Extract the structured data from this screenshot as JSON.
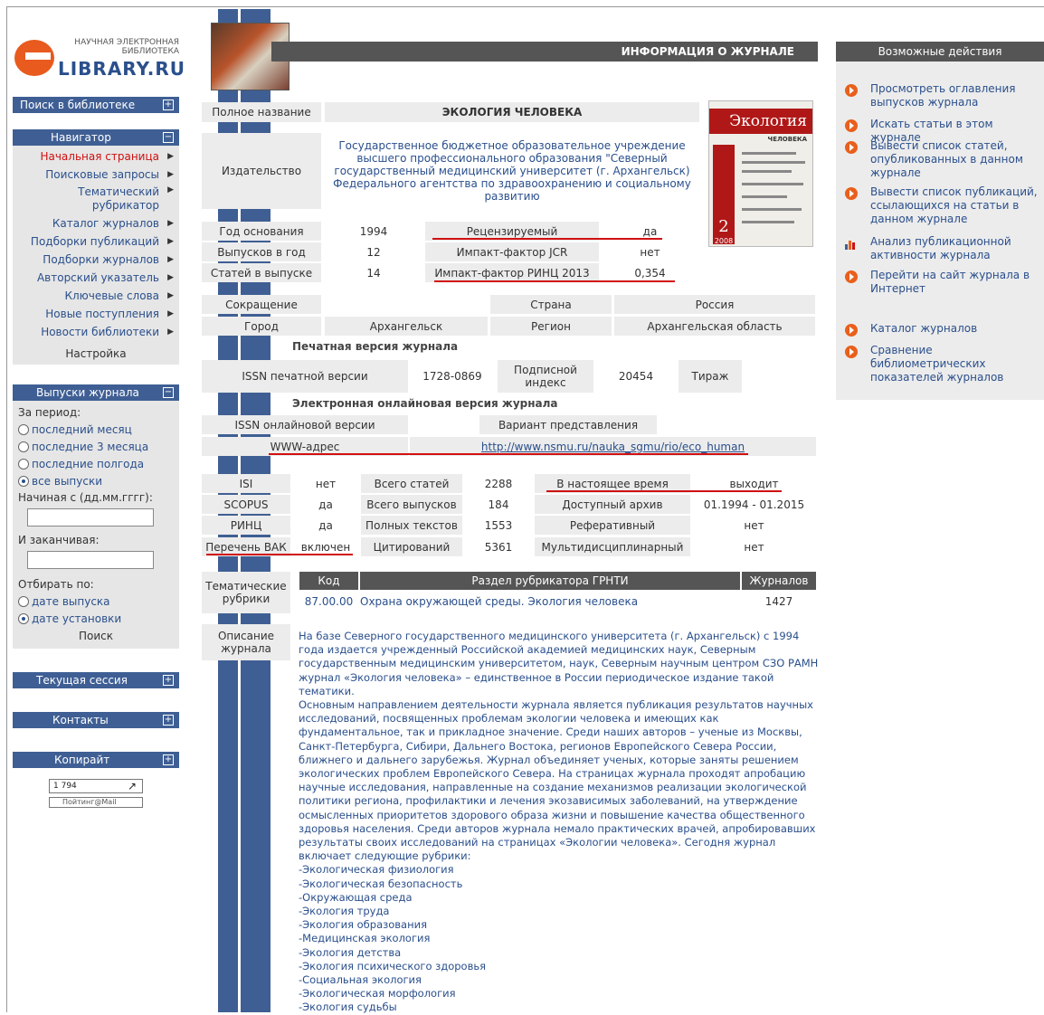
{
  "logo": {
    "line1": "НАУЧНАЯ ЭЛЕКТРОННАЯ",
    "line2": "БИБЛИОТЕКА",
    "brand": "LIBRARY.RU"
  },
  "left": {
    "search_panel": "Поиск в библиотеке",
    "navigator_panel": "Навигатор",
    "nav_items": [
      "Начальная страница",
      "Поисковые запросы",
      "Тематический рубрикатор",
      "Каталог журналов",
      "Подборки публикаций",
      "Подборки журналов",
      "Авторский указатель",
      "Ключевые слова",
      "Новые поступления",
      "Новости библиотеки"
    ],
    "settings": "Настройка",
    "issues_panel": "Выпуски журнала",
    "period_label": "За период:",
    "period_options": [
      "последний месяц",
      "последние 3 месяца",
      "последние полгода",
      "все выпуски"
    ],
    "start_label": "Начиная с (дд.мм.гггг):",
    "end_label": "И заканчивая:",
    "sort_label": "Отбирать по:",
    "sort_options": [
      "дате выпуска",
      "дате установки"
    ],
    "search_btn": "Поиск",
    "session_panel": "Текущая сессия",
    "contacts_panel": "Контакты",
    "copyright_panel": "Копирайт",
    "counter": "1 794",
    "counter2": "Пойтинг@Mail"
  },
  "header": {
    "title": "ИНФОРМАЦИЯ О ЖУРНАЛЕ"
  },
  "journal": {
    "full_name_label": "Полное название",
    "full_name": "ЭКОЛОГИЯ ЧЕЛОВЕКА",
    "publisher_label": "Издательство",
    "publisher_lines": [
      "Государственное бюджетное образовательное учреждение",
      "высшего профессионального образования \"Северный",
      "государственный медицинский университет (г. Архангельск)",
      "Федерального агентства по здравоохранению и социальному",
      "развитию"
    ],
    "founded_label": "Год основания",
    "founded": "1994",
    "reviewed_label": "Рецензируемый",
    "reviewed": "да",
    "issues_label": "Выпусков в год",
    "issues": "12",
    "jcr_label": "Импакт-фактор JCR",
    "jcr": "нет",
    "articles_label": "Статей в выпуске",
    "articles": "14",
    "rinc_if_label": "Импакт-фактор РИНЦ 2013",
    "rinc_if": "0,354",
    "abbr_label": "Сокращение",
    "country_label": "Страна",
    "country": "Россия",
    "city_label": "Город",
    "city": "Архангельск",
    "region_label": "Регион",
    "region": "Архангельская область",
    "print_section": "Печатная версия журнала",
    "issn_print_label": "ISSN печатной версии",
    "issn_print": "1728-0869",
    "sub_index_label": "Подписной индекс",
    "sub_index": "20454",
    "circulation_label": "Тираж",
    "online_section": "Электронная онлайновая версия журнала",
    "issn_online_label": "ISSN онлайновой версии",
    "variant_label": "Вариант представления",
    "www_label": "WWW-адрес",
    "www": "http://www.nsmu.ru/nauka_sgmu/rio/eco_human",
    "isi_label": "ISI",
    "isi": "нет",
    "total_articles_label": "Всего статей",
    "total_articles": "2288",
    "current_label": "В настоящее время",
    "current": "выходит",
    "scopus_label": "SCOPUS",
    "scopus": "да",
    "total_issues_label": "Всего выпусков",
    "total_issues": "184",
    "archive_label": "Доступный архив",
    "archive": "01.1994 - 01.2015",
    "rinc_label": "РИНЦ",
    "rinc": "да",
    "fulltext_label": "Полных текстов",
    "fulltext": "1553",
    "abstract_label": "Реферативный",
    "abstract": "нет",
    "vak_label": "Перечень ВАК",
    "vak": "включен",
    "citations_label": "Цитирований",
    "citations": "5361",
    "multi_label": "Мультидисциплинарный",
    "multi": "нет"
  },
  "rubrics": {
    "label": "Тематические рубрики",
    "code_h": "Код",
    "section_h": "Раздел рубрикатора ГРНТИ",
    "count_h": "Журналов",
    "code": "87.00.00",
    "section": "Охрана окружающей среды. Экология человека",
    "count": "1427"
  },
  "description": {
    "label": "Описание журнала",
    "lines": [
      "На базе Северного государственного медицинского университета (г. Архангельск) с 1994",
      "года издается учрежденный Российской академией медицинских наук, Северным",
      "государственным медицинским университетом, наук, Северным научным центром СЗО РАМН",
      "журнал «Экология человека» – единственное в России периодическое издание такой",
      "тематики.",
      "Основным направлением деятельности журнала является публикация результатов научных",
      "исследований, посвященных проблемам экологии человека и имеющих как",
      "фундаментальное, так и прикладное значение. Среди наших авторов – ученые из Москвы,",
      "Санкт-Петербурга, Сибири, Дальнего Востока, регионов Европейского Севера России,",
      "ближнего и дальнего зарубежья. Журнал объединяет ученых, которые заняты решением",
      "экологических проблем Европейского Севера. На страницах журнала проходят апробацию",
      "научные исследования, направленные на создание механизмов реализации экологической",
      "политики региона, профилактики и лечения экозависимых заболеваний, на утверждение",
      "осмысленных приоритетов здорового образа жизни и повышение качества общественного",
      "здоровья населения. Среди авторов журнала немало практических врачей, апробировавших",
      "результаты своих исследований на страницах «Экологии человека». Сегодня журнал",
      "включает следующие рубрики:",
      "-Экологическая физиология",
      "-Экологическая безопасность",
      "-Окружающая среда",
      "-Экология труда",
      "-Экология образования",
      "-Медицинская экология",
      "-Экология детства",
      "-Экология психического здоровья",
      "-Социальная экология",
      "-Экологическая морфология",
      "-Экология судьбы"
    ]
  },
  "cover": {
    "title": "Экология",
    "subtitle": "ЧЕЛОВЕКА",
    "issue": "2",
    "year": "2008"
  },
  "actions": {
    "title": "Возможные действия",
    "items": [
      "Просмотреть оглавления выпусков журнала",
      "Искать статьи в этом журнале",
      "Вывести список статей, опубликованных в данном журнале",
      "Вывести список публикаций, ссылающихся на статьи в данном журнале",
      "Анализ публикационной активности журнала",
      "Перейти на сайт журнала в Интернет",
      "Каталог журналов",
      "Сравнение библиометрических показателей журналов"
    ]
  },
  "colors": {
    "accent": "#3f5f94",
    "header": "#555555",
    "highlight": "#d01010",
    "link": "#2a4f8c",
    "icon": "#e8601c"
  }
}
